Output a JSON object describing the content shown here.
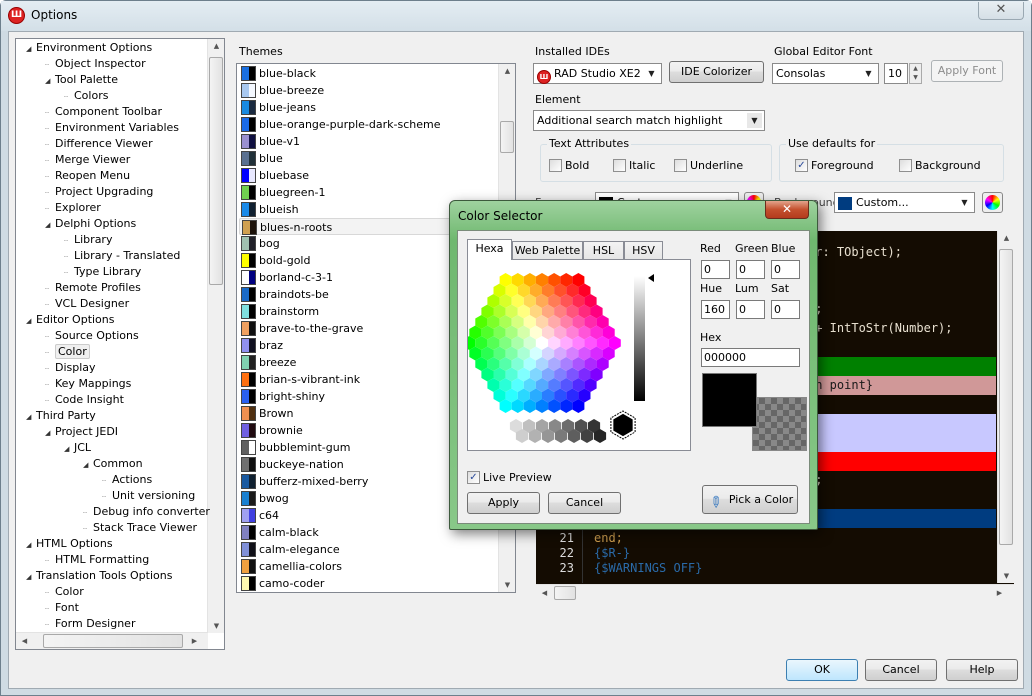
{
  "window": {
    "title": "Options",
    "close_glyph": "✕",
    "app_icon": "rad-studio-icon"
  },
  "tree": {
    "items": [
      {
        "label": "Environment Options",
        "level": 0,
        "expanded": true
      },
      {
        "label": "Object Inspector",
        "level": 1
      },
      {
        "label": "Tool Palette",
        "level": 1,
        "expanded": true
      },
      {
        "label": "Colors",
        "level": 2
      },
      {
        "label": "Component Toolbar",
        "level": 1
      },
      {
        "label": "Environment Variables",
        "level": 1
      },
      {
        "label": "Difference Viewer",
        "level": 1
      },
      {
        "label": "Merge Viewer",
        "level": 1
      },
      {
        "label": "Reopen Menu",
        "level": 1
      },
      {
        "label": "Project Upgrading",
        "level": 1
      },
      {
        "label": "Explorer",
        "level": 1
      },
      {
        "label": "Delphi Options",
        "level": 1,
        "expanded": true
      },
      {
        "label": "Library",
        "level": 2
      },
      {
        "label": "Library - Translated",
        "level": 2
      },
      {
        "label": "Type Library",
        "level": 2
      },
      {
        "label": "Remote Profiles",
        "level": 1
      },
      {
        "label": "VCL Designer",
        "level": 1
      },
      {
        "label": "Editor Options",
        "level": 0,
        "expanded": true
      },
      {
        "label": "Source Options",
        "level": 1
      },
      {
        "label": "Color",
        "level": 1,
        "selected": true
      },
      {
        "label": "Display",
        "level": 1
      },
      {
        "label": "Key Mappings",
        "level": 1
      },
      {
        "label": "Code Insight",
        "level": 1
      },
      {
        "label": "Third Party",
        "level": 0,
        "expanded": true
      },
      {
        "label": "Project JEDI",
        "level": 1,
        "expanded": true
      },
      {
        "label": "JCL",
        "level": 2,
        "expanded": true
      },
      {
        "label": "Common",
        "level": 3,
        "expanded": true
      },
      {
        "label": "Actions",
        "level": 4
      },
      {
        "label": "Unit versioning",
        "level": 4
      },
      {
        "label": "Debug info converter",
        "level": 3
      },
      {
        "label": "Stack Trace Viewer",
        "level": 3
      },
      {
        "label": "HTML Options",
        "level": 0,
        "expanded": true
      },
      {
        "label": "HTML Formatting",
        "level": 1
      },
      {
        "label": "Translation Tools Options",
        "level": 0,
        "expanded": true
      },
      {
        "label": "Color",
        "level": 1
      },
      {
        "label": "Font",
        "level": 1
      },
      {
        "label": "Form Designer",
        "level": 1
      }
    ]
  },
  "themes": {
    "label": "Themes",
    "selected": "blues-n-roots",
    "items": [
      {
        "name": "blue-black",
        "colors": [
          "#1a6fe0",
          "#000000"
        ]
      },
      {
        "name": "blue-breeze",
        "colors": [
          "#a8c8f0",
          "#f4f8ff"
        ]
      },
      {
        "name": "blue-jeans",
        "colors": [
          "#1a8ae0",
          "#1a2a40"
        ]
      },
      {
        "name": "blue-orange-purple-dark-scheme",
        "colors": [
          "#1a6ae8",
          "#000000"
        ]
      },
      {
        "name": "blue-v1",
        "colors": [
          "#9a90d0",
          "#101040"
        ]
      },
      {
        "name": "blue",
        "colors": [
          "#5a7090",
          "#203038"
        ]
      },
      {
        "name": "bluebase",
        "colors": [
          "#0000ff",
          "#e8e8ff"
        ]
      },
      {
        "name": "bluegreen-1",
        "colors": [
          "#70d050",
          "#000000"
        ]
      },
      {
        "name": "blueish",
        "colors": [
          "#1a8ae8",
          "#102030"
        ]
      },
      {
        "name": "blues-n-roots",
        "colors": [
          "#d0a050",
          "#1a1008"
        ]
      },
      {
        "name": "bog",
        "colors": [
          "#a0c0b0",
          "#202028"
        ]
      },
      {
        "name": "bold-gold",
        "colors": [
          "#ffff00",
          "#000000"
        ]
      },
      {
        "name": "borland-c-3-1",
        "colors": [
          "#ffffff",
          "#000080"
        ]
      },
      {
        "name": "braindots-be",
        "colors": [
          "#1a6ac8",
          "#000000"
        ]
      },
      {
        "name": "brainstorm",
        "colors": [
          "#80e0e0",
          "#000000"
        ]
      },
      {
        "name": "brave-to-the-grave",
        "colors": [
          "#f0a060",
          "#101010"
        ]
      },
      {
        "name": "braz",
        "colors": [
          "#9090f0",
          "#101020"
        ]
      },
      {
        "name": "breeze",
        "colors": [
          "#80d0b0",
          "#202020"
        ]
      },
      {
        "name": "brian-s-vibrant-ink",
        "colors": [
          "#ff7010",
          "#000000"
        ]
      },
      {
        "name": "bright-shiny",
        "colors": [
          "#2a60f0",
          "#000000"
        ]
      },
      {
        "name": "Brown",
        "colors": [
          "#f09050",
          "#503010"
        ]
      },
      {
        "name": "brownie",
        "colors": [
          "#7060e0",
          "#200a10"
        ]
      },
      {
        "name": "bubblemint-gum",
        "colors": [
          "#606060",
          "#ffffff"
        ]
      },
      {
        "name": "buckeye-nation",
        "colors": [
          "#707070",
          "#101010"
        ]
      },
      {
        "name": "bufferz-mixed-berry",
        "colors": [
          "#1a5aa0",
          "#102030"
        ]
      },
      {
        "name": "bwog",
        "colors": [
          "#1a80d0",
          "#1a1a1a"
        ]
      },
      {
        "name": "c64",
        "colors": [
          "#a0a0f0",
          "#4040e0"
        ]
      },
      {
        "name": "calm-black",
        "colors": [
          "#8080c0",
          "#000000"
        ]
      },
      {
        "name": "calm-elegance",
        "colors": [
          "#8090d8",
          "#101018"
        ]
      },
      {
        "name": "camellia-colors",
        "colors": [
          "#f0a040",
          "#101010"
        ]
      },
      {
        "name": "camo-coder",
        "colors": [
          "#fff8b0",
          "#000000"
        ]
      }
    ]
  },
  "ide": {
    "installed_label": "Installed IDEs",
    "installed_value": "RAD Studio XE2",
    "colorizer_button": "IDE Colorizer",
    "font_label": "Global Editor Font",
    "font_value": "Consolas",
    "font_size": "10",
    "apply_font_button": "Apply Font"
  },
  "element": {
    "label": "Element",
    "value": "Additional search match highlight"
  },
  "text_attributes": {
    "label": "Text Attributes",
    "bold": {
      "label": "Bold",
      "checked": false
    },
    "italic": {
      "label": "Italic",
      "checked": false
    },
    "underline": {
      "label": "Underline",
      "checked": false
    }
  },
  "use_defaults": {
    "label": "Use defaults for",
    "foreground": {
      "label": "Foreground",
      "checked": true
    },
    "background": {
      "label": "Background",
      "checked": false
    }
  },
  "colors": {
    "foreground_label": "Foreground",
    "foreground_value": "Custom...",
    "foreground_swatch": "#000000",
    "background_label": "Background",
    "background_value": "Custom...",
    "background_swatch": "#003c80"
  },
  "code_preview": {
    "background": "#140c02",
    "lines": [
      {
        "text": "er: TObject);",
        "bg": null
      },
      {
        "text": "",
        "bg": null
      },
      {
        "text": "",
        "bg": null
      },
      {
        "text": ");",
        "bg": null
      },
      {
        "text": " + IntToStr(Number);",
        "bg": null
      },
      {
        "text": "",
        "bg": null
      },
      {
        "text": "",
        "bg": "#008000"
      },
      {
        "text": "on point}",
        "bg": "#d09898",
        "color": "#1a1a1a"
      },
      {
        "text": "",
        "bg": null
      },
      {
        "text": "",
        "bg": "#c8c8ff"
      },
      {
        "text": "",
        "bg": "#c8c8ff"
      },
      {
        "text": "",
        "bg": "#ff0000"
      },
      {
        "text": ");",
        "bg": null
      },
      {
        "text": "",
        "bg": null
      },
      {
        "text": "",
        "bg": "#003c80"
      }
    ],
    "numbered_lines": [
      {
        "num": "21",
        "text": "end;",
        "color": "#d0a050"
      },
      {
        "num": "22",
        "text": "{$R-}",
        "color": "#2a6aa8"
      },
      {
        "num": "23",
        "text": "{$WARNINGS OFF}",
        "color": "#2a6aa8"
      }
    ]
  },
  "color_selector": {
    "title": "Color Selector",
    "tabs": [
      "Hexa",
      "Web Palette",
      "HSL",
      "HSV"
    ],
    "active_tab": "Hexa",
    "red_label": "Red",
    "red": "0",
    "green_label": "Green",
    "green": "0",
    "blue_label": "Blue",
    "blue": "0",
    "hue_label": "Hue",
    "hue": "160",
    "lum_label": "Lum",
    "lum": "0",
    "sat_label": "Sat",
    "sat": "0",
    "hex_label": "Hex",
    "hex": "000000",
    "preview_color": "#000000",
    "live_preview": {
      "label": "Live Preview",
      "checked": true
    },
    "apply_button": "Apply",
    "cancel_button": "Cancel",
    "pick_button": "Pick a Color"
  },
  "footer": {
    "ok": "OK",
    "cancel": "Cancel",
    "help": "Help"
  }
}
